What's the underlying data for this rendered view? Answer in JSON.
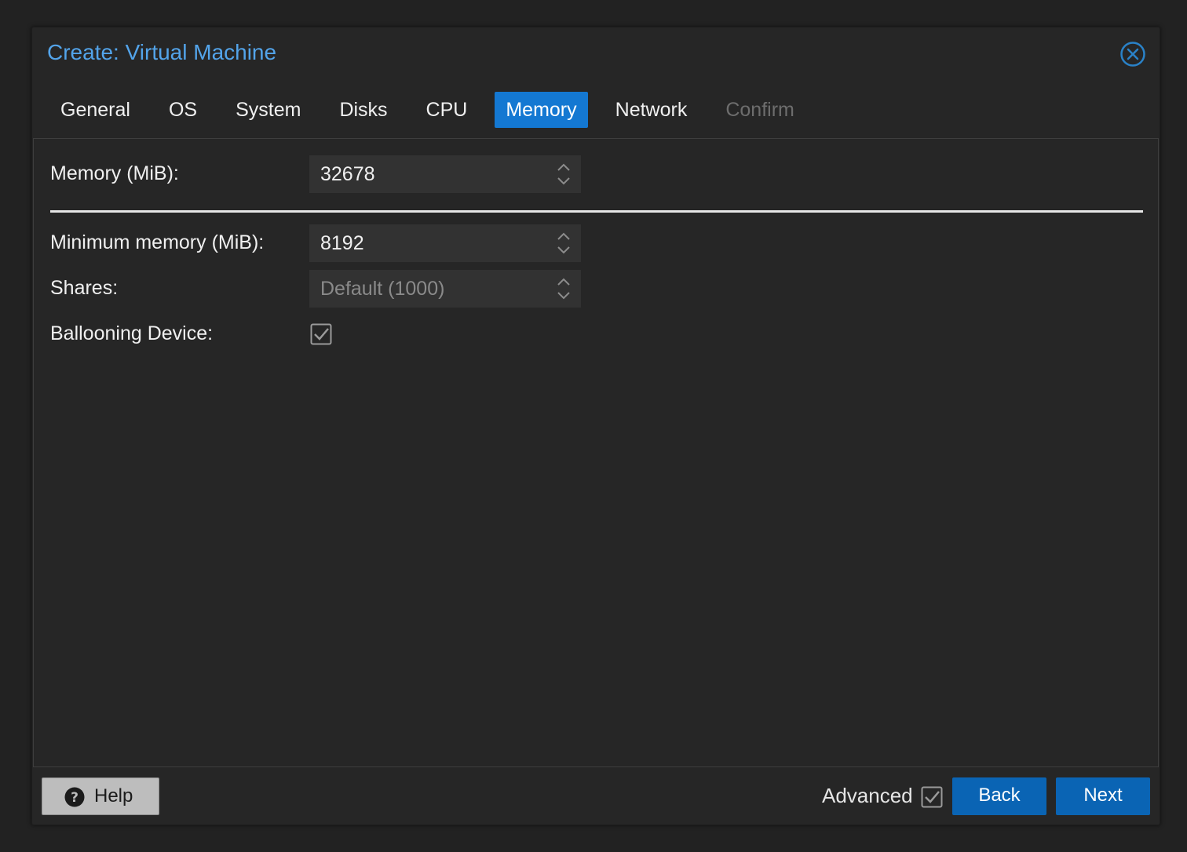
{
  "dialog": {
    "title": "Create: Virtual Machine"
  },
  "tabs": [
    {
      "label": "General",
      "state": "normal"
    },
    {
      "label": "OS",
      "state": "normal"
    },
    {
      "label": "System",
      "state": "normal"
    },
    {
      "label": "Disks",
      "state": "normal"
    },
    {
      "label": "CPU",
      "state": "normal"
    },
    {
      "label": "Memory",
      "state": "active"
    },
    {
      "label": "Network",
      "state": "normal"
    },
    {
      "label": "Confirm",
      "state": "disabled"
    }
  ],
  "form": {
    "memory": {
      "label": "Memory (MiB):",
      "value": "32678"
    },
    "min_memory": {
      "label": "Minimum memory (MiB):",
      "value": "8192"
    },
    "shares": {
      "label": "Shares:",
      "placeholder": "Default (1000)"
    },
    "ballooning": {
      "label": "Ballooning Device:",
      "checked": true
    }
  },
  "footer": {
    "help_label": "Help",
    "advanced_label": "Advanced",
    "advanced_checked": true,
    "back_label": "Back",
    "next_label": "Next"
  },
  "colors": {
    "accent": "#1478d2",
    "title": "#53a4ea",
    "button": "#0a64b4"
  }
}
